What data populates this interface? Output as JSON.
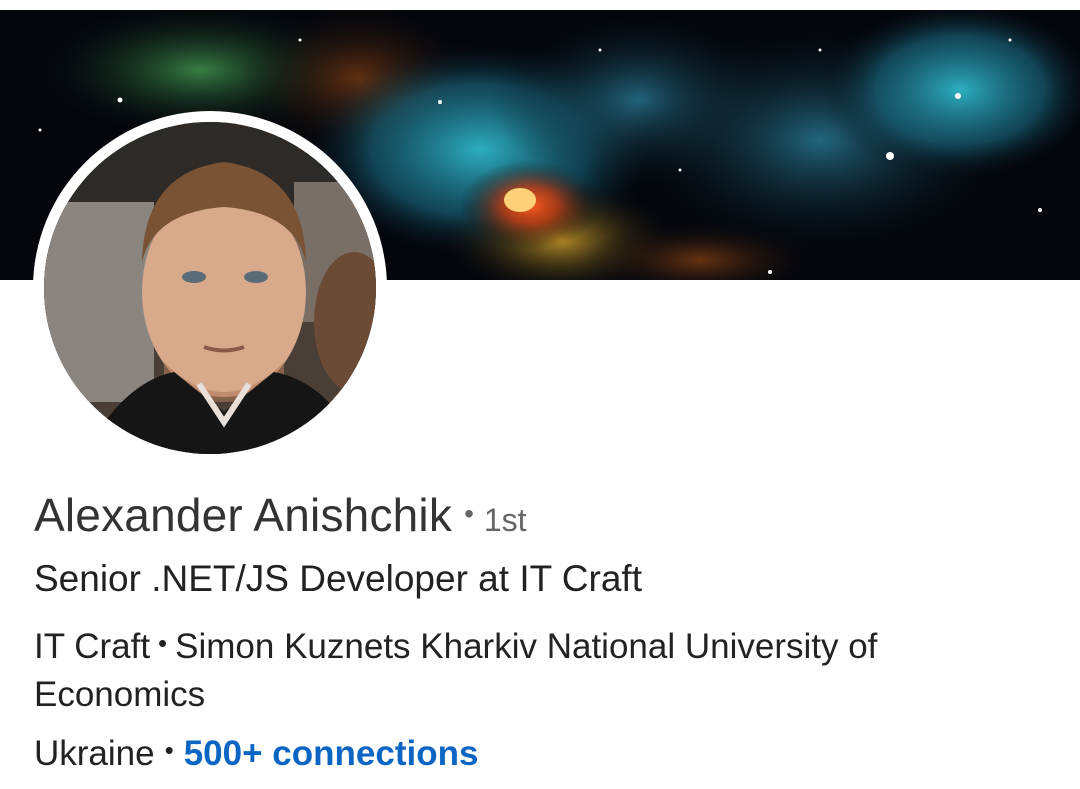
{
  "profile": {
    "name": "Alexander Anishchik",
    "separator": "•",
    "degree": "1st",
    "headline": "Senior .NET/JS Developer at IT Craft",
    "company": "IT Craft",
    "education": "Simon Kuznets Kharkiv National University of Economics",
    "location": "Ukraine",
    "connections_label": "500+ connections"
  },
  "images": {
    "banner": "space-nebula-banner",
    "avatar": "profile-photo"
  },
  "colors": {
    "link": "#0a66c2",
    "text": "#222222",
    "secondary": "#666666"
  }
}
